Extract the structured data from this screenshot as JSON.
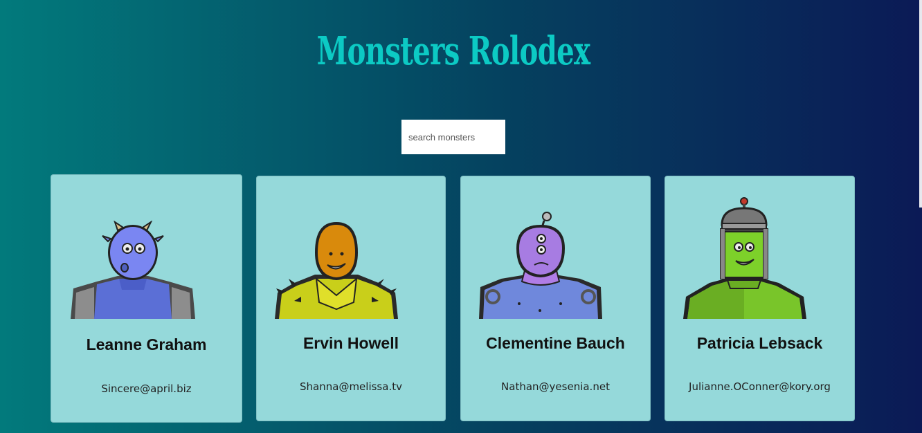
{
  "app": {
    "title": "Monsters Rolodex"
  },
  "search": {
    "placeholder": "search monsters",
    "value": ""
  },
  "monsters": [
    {
      "name": "Leanne Graham",
      "email": "Sincere@april.biz",
      "avatar": "blue-horned-monster",
      "color": "#7a86f2"
    },
    {
      "name": "Ervin Howell",
      "email": "Shanna@melissa.tv",
      "avatar": "orange-spiky-monster",
      "color": "#d98a0c"
    },
    {
      "name": "Clementine Bauch",
      "email": "Nathan@yesenia.net",
      "avatar": "purple-cyclops-robot-monster",
      "color": "#a77ce2"
    },
    {
      "name": "Patricia Lebsack",
      "email": "Julianne.OConner@kory.org",
      "avatar": "green-helmet-monster",
      "color": "#7dd12a"
    }
  ],
  "colors": {
    "title": "#0ccac4",
    "card_background": "#95d9da",
    "gradient_start": "#027a7c",
    "gradient_end": "#0b1a56"
  }
}
